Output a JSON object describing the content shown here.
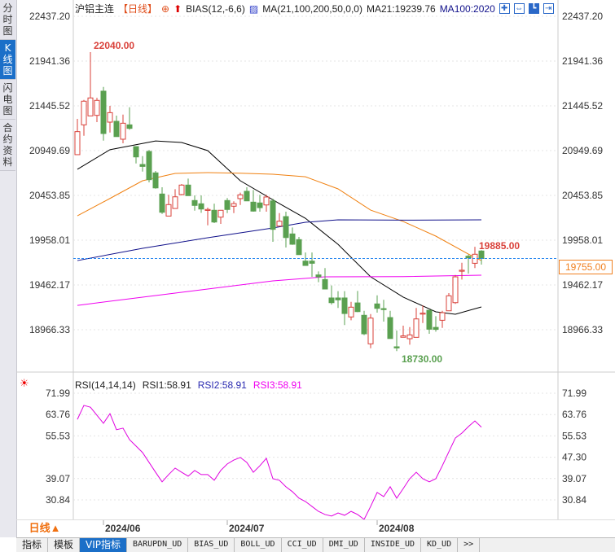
{
  "sidebar": {
    "items": [
      {
        "label": "分时图",
        "active": false
      },
      {
        "label": "K线图",
        "active": true
      },
      {
        "label": "闪电图",
        "active": false
      },
      {
        "label": "合约资料",
        "active": false
      }
    ]
  },
  "header": {
    "symbol": "沪铝主连",
    "period": "【日线】",
    "bias": "BIAS(12,-6,6)",
    "ma_params": "MA(21,100,200,50,0,0)",
    "ma21": "MA21:19239.76",
    "ma100": "MA100:2020",
    "toolbar_icons": [
      "crosshair-icon",
      "zoom-range-icon",
      "bar-chart-icon",
      "exit-icon"
    ]
  },
  "price_axis": {
    "labels": [
      "22437.20",
      "21941.36",
      "21445.52",
      "20949.69",
      "20453.85",
      "19958.01",
      "19462.17",
      "18966.33"
    ]
  },
  "current_price": "19755.00",
  "annotations": {
    "high": "22040.00",
    "low": "18730.00",
    "recent_high": "19885.00"
  },
  "rsi": {
    "title": "RSI(14,14,14)",
    "rsi1": "RSI1:58.91",
    "rsi2": "RSI2:58.91",
    "rsi3": "RSI3:58.91",
    "left_labels": [
      "71.99",
      "63.76",
      "55.53",
      "39.07",
      "30.84"
    ],
    "right_labels": [
      "71.99",
      "63.76",
      "55.53",
      "47.30",
      "39.07",
      "30.84"
    ]
  },
  "date_axis": {
    "period_button": "日线▲",
    "labels": [
      {
        "text": "2024/06",
        "index": 4
      },
      {
        "text": "2024/07",
        "index": 23
      },
      {
        "text": "2024/08",
        "index": 46
      }
    ]
  },
  "bottom_tabs": [
    "指标",
    "模板",
    "VIP指标",
    "BARUPDN_UD",
    "BIAS_UD",
    "BOLL_UD",
    "CCI_UD",
    "DMI_UD",
    "INSIDE_UD",
    "KD_UD",
    ">>"
  ],
  "bottom_tabs_active": 2,
  "colors": {
    "up": "#d9413a",
    "down": "#5aa050",
    "ma21": "#000000",
    "ma_orange": "#f08010",
    "ma_navy": "#10108a",
    "ma_magenta": "#f000f0",
    "rsi": "#e000e0",
    "current_line": "#2a88f0"
  },
  "chart_data": {
    "type": "candlestick",
    "ylim": [
      18730,
      22437.2
    ],
    "ohlc": [
      [
        20905,
        21160,
        21301,
        20905
      ],
      [
        21235,
        21497,
        21511,
        21114
      ],
      [
        21334,
        21533,
        22040,
        21334
      ],
      [
        21340,
        21506,
        21535,
        21265
      ],
      [
        21608,
        21139,
        21655,
        21060
      ],
      [
        21265,
        21370,
        21445,
        21150
      ],
      [
        21274,
        21105,
        21337,
        21105
      ],
      [
        21076,
        21253,
        21349,
        21031
      ],
      [
        21235,
        21196,
        21430,
        21181
      ],
      [
        20994,
        20880,
        20994,
        20808
      ],
      [
        20796,
        20775,
        20889,
        20718
      ],
      [
        20940,
        20628,
        20958,
        20598
      ],
      [
        20703,
        20537,
        20724,
        20528
      ],
      [
        20469,
        20267,
        20544,
        20249
      ],
      [
        20225,
        20352,
        20460,
        20225
      ],
      [
        20309,
        20438,
        20523,
        20309
      ],
      [
        20463,
        20568,
        20580,
        20454
      ],
      [
        20568,
        20451,
        20640,
        20451
      ],
      [
        20397,
        20343,
        20454,
        20285
      ],
      [
        20361,
        20303,
        20454,
        20261
      ],
      [
        20289,
        20298,
        20318,
        20123
      ],
      [
        20289,
        20159,
        20363,
        20147
      ],
      [
        20213,
        20289,
        20289,
        20138
      ],
      [
        20397,
        20298,
        20424,
        20258
      ],
      [
        20334,
        20363,
        20388,
        20258
      ],
      [
        20418,
        20460,
        20484,
        20348
      ],
      [
        20499,
        20393,
        20544,
        20393
      ],
      [
        20379,
        20280,
        20514,
        20273
      ],
      [
        20370,
        20318,
        20460,
        20273
      ],
      [
        20348,
        20436,
        20460,
        20273
      ],
      [
        20393,
        20078,
        20417,
        19940
      ],
      [
        20114,
        20168,
        20258,
        20114
      ],
      [
        20219,
        19987,
        20273,
        19877
      ],
      [
        20027,
        19913,
        20099,
        19906
      ],
      [
        19964,
        19798,
        19994,
        19798
      ],
      [
        19726,
        19678,
        19822,
        19678
      ],
      [
        19726,
        19702,
        19822,
        19552
      ],
      [
        19573,
        19552,
        19612,
        19492
      ],
      [
        19522,
        19417,
        19649,
        19417
      ],
      [
        19318,
        19266,
        19456,
        19245
      ],
      [
        19318,
        19297,
        19393,
        19207
      ],
      [
        19318,
        19146,
        19393,
        19018
      ],
      [
        19108,
        19216,
        19275,
        19071
      ],
      [
        19263,
        19167,
        19396,
        19161
      ],
      [
        19126,
        18921,
        19176,
        18906
      ],
      [
        18810,
        19095,
        19140,
        18761
      ],
      [
        19252,
        19203,
        19347,
        19155
      ],
      [
        19200,
        19194,
        19297,
        19056
      ],
      [
        19101,
        18869,
        19176,
        18869
      ],
      [
        18777,
        18765,
        18957,
        18730
      ],
      [
        18883,
        18898,
        19011,
        18883
      ],
      [
        18867,
        18909,
        18996,
        18801
      ],
      [
        18882,
        19086,
        19207,
        18882
      ],
      [
        19140,
        19150,
        19236,
        19041
      ],
      [
        19182,
        18972,
        19182,
        18921
      ],
      [
        18992,
        18970,
        19116,
        18945
      ],
      [
        19071,
        19155,
        19176,
        18987
      ],
      [
        19176,
        19342,
        19372,
        19176
      ],
      [
        19266,
        19552,
        19573,
        19252
      ],
      [
        19617,
        19625,
        19708,
        19522
      ],
      [
        19780,
        19762,
        19798,
        19588
      ],
      [
        19702,
        19802,
        19885,
        19649
      ],
      [
        19838,
        19755,
        19847,
        19687
      ]
    ],
    "ma_lines": [
      {
        "name": "MA21",
        "color": "#000000",
        "points": [
          [
            0,
            20743
          ],
          [
            5,
            20960
          ],
          [
            12,
            21057
          ],
          [
            16,
            21040
          ],
          [
            20,
            20950
          ],
          [
            25,
            20616
          ],
          [
            31,
            20363
          ],
          [
            35,
            20200
          ],
          [
            40,
            19912
          ],
          [
            45,
            19552
          ],
          [
            50,
            19327
          ],
          [
            55,
            19165
          ],
          [
            58,
            19138
          ],
          [
            62,
            19219
          ]
        ]
      },
      {
        "color": "#f08010",
        "points": [
          [
            0,
            20228
          ],
          [
            5,
            20420
          ],
          [
            10,
            20616
          ],
          [
            15,
            20697
          ],
          [
            20,
            20706
          ],
          [
            25,
            20700
          ],
          [
            30,
            20688
          ],
          [
            35,
            20660
          ],
          [
            40,
            20526
          ],
          [
            45,
            20291
          ],
          [
            50,
            20165
          ],
          [
            55,
            20003
          ],
          [
            60,
            19804
          ],
          [
            62,
            19732
          ]
        ]
      },
      {
        "name": "MA100",
        "color": "#10108a",
        "points": [
          [
            0,
            19732
          ],
          [
            10,
            19868
          ],
          [
            20,
            19985
          ],
          [
            30,
            20093
          ],
          [
            35,
            20156
          ],
          [
            40,
            20183
          ],
          [
            50,
            20180
          ],
          [
            62,
            20183
          ]
        ]
      },
      {
        "color": "#f000f0",
        "points": [
          [
            0,
            19236
          ],
          [
            10,
            19327
          ],
          [
            20,
            19417
          ],
          [
            30,
            19507
          ],
          [
            38,
            19552
          ],
          [
            50,
            19555
          ],
          [
            62,
            19570
          ]
        ]
      }
    ],
    "rsi": {
      "ylim": [
        20,
        75
      ],
      "values": [
        61.9,
        67.3,
        66.6,
        63.5,
        60.4,
        64.1,
        57.9,
        58.5,
        54.1,
        51.6,
        49.1,
        45.3,
        41.5,
        37.8,
        40.6,
        43.1,
        41.5,
        40.0,
        42.2,
        40.6,
        40.6,
        38.4,
        42.2,
        44.7,
        46.2,
        47.2,
        45.3,
        41.5,
        44.0,
        46.9,
        39.0,
        38.4,
        35.9,
        34.0,
        31.5,
        30.2,
        28.3,
        26.4,
        25.2,
        24.6,
        25.8,
        24.9,
        26.4,
        25.2,
        23.3,
        28.3,
        33.7,
        32.1,
        35.9,
        31.5,
        35.2,
        39.0,
        41.5,
        39.0,
        37.8,
        39.0,
        44.0,
        49.4,
        54.7,
        56.6,
        59.1,
        61.3,
        58.9
      ]
    }
  }
}
